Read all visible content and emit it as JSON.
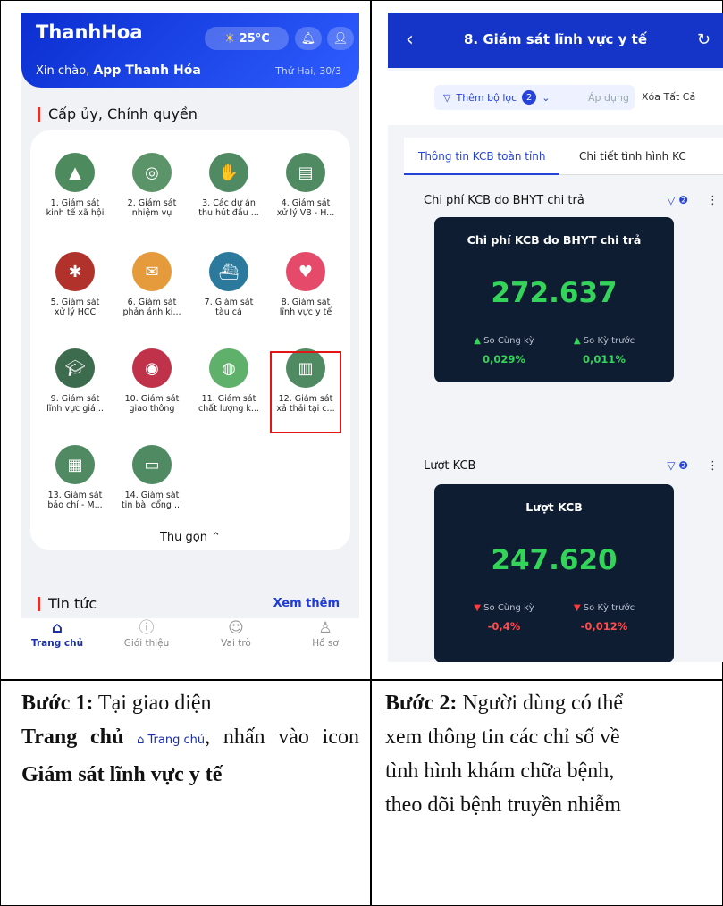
{
  "left": {
    "logo": "ThanhHoa",
    "weather": "25°C",
    "greeting": "Xin chào,",
    "user": "App Thanh Hóa",
    "date": "Thứ Hai, 30/3",
    "section": "Cấp ủy, Chính quyền",
    "apps": [
      [
        "1. Giám sát",
        "kinh tế xã hội"
      ],
      [
        "2. Giám sát",
        "nhiệm vụ"
      ],
      [
        "3. Các dự án",
        "thu hút đầu ..."
      ],
      [
        "4. Giám sát",
        "xử lý VB - H..."
      ],
      [
        "5. Giám sát",
        "xử lý HCC"
      ],
      [
        "6. Giám sát",
        "phản ánh ki..."
      ],
      [
        "7. Giám sát",
        "tàu cá"
      ],
      [
        "8. Giám sát",
        "lĩnh vực y tế"
      ],
      [
        "9. Giám sát",
        "lĩnh vực giá..."
      ],
      [
        "10. Giám sát",
        "giao thông"
      ],
      [
        "11. Giám sát",
        "chất lượng k..."
      ],
      [
        "12. Giám sát",
        "xả thải tại c..."
      ],
      [
        "13. Giám sát",
        "báo chí - M..."
      ],
      [
        "14. Giám sát",
        "tin bài cổng ..."
      ]
    ],
    "collapse": "Thu gọn",
    "news": "Tin tức",
    "more": "Xem thêm",
    "nav": [
      "Trang chủ",
      "Giới thiệu",
      "Vai trò",
      "Hồ sơ"
    ]
  },
  "right": {
    "title": "8. Giám sát lĩnh vực y tế",
    "filter": "Thêm bộ lọc",
    "filter_count": "2",
    "apply": "Áp dụng",
    "clear": "Xóa Tất Cả",
    "tab1": "Thông tin KCB toàn tỉnh",
    "tab2": "Chi tiết tình hình KC",
    "card1": {
      "head": "Chi phí KCB do BHYT chi trả",
      "count": "2",
      "title": "Chi phí KCB do BHYT chi trả",
      "value": "272.637",
      "c1": "So Cùng kỳ",
      "v1": "0,029%",
      "c2": "So Kỳ trước",
      "v2": "0,011%"
    },
    "card2": {
      "head": "Lượt KCB",
      "count": "2",
      "title": "Lượt KCB",
      "value": "247.620",
      "c1": "So Cùng kỳ",
      "v1": "-0,4%",
      "c2": "So Kỳ trước",
      "v2": "-0,012%"
    }
  },
  "captions": {
    "c1_step": "Bước 1:",
    "c1_a": "Tại giao diện",
    "c1_home": "Trang chủ",
    "c1_icon_label": "Trang chủ",
    "c1_b": ", nhấn vào icon",
    "c1_target": "Giám sát lĩnh vực y tế",
    "c2_step": "Bước 2:",
    "c2_lines": [
      "Người dùng có thể",
      "xem thông tin các chỉ số về",
      "tình hình khám chữa bệnh,",
      "theo dõi bệnh truyền nhiễm"
    ]
  }
}
